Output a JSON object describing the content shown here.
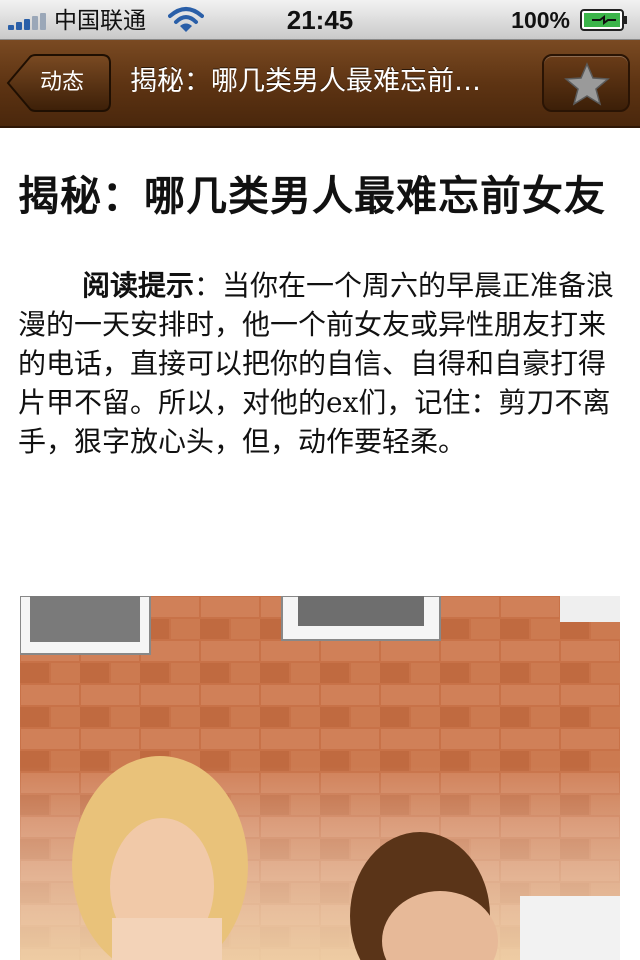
{
  "status_bar": {
    "carrier": "中国联通",
    "time": "21:45",
    "battery": "100%"
  },
  "nav": {
    "back_label": "动态",
    "title": "揭秘：哪几类男人最难忘前…",
    "favorite_icon": "star-icon"
  },
  "article": {
    "headline": "揭秘：哪几类男人最难忘前女友",
    "summary_label": "阅读提示",
    "summary_sep": "：",
    "summary_text": "当你在一个周六的早晨正准备浪漫的一天安排时，他一个前女友或异性朋友打来的电话，直接可以把你的自信、自得和自豪打得片甲不留。所以，对他的ex们，记住：剪刀不离手，狠字放心头，但，动作要轻柔。"
  },
  "colors": {
    "nav_brown": "#5e3413",
    "brick": "#c46a3c"
  }
}
